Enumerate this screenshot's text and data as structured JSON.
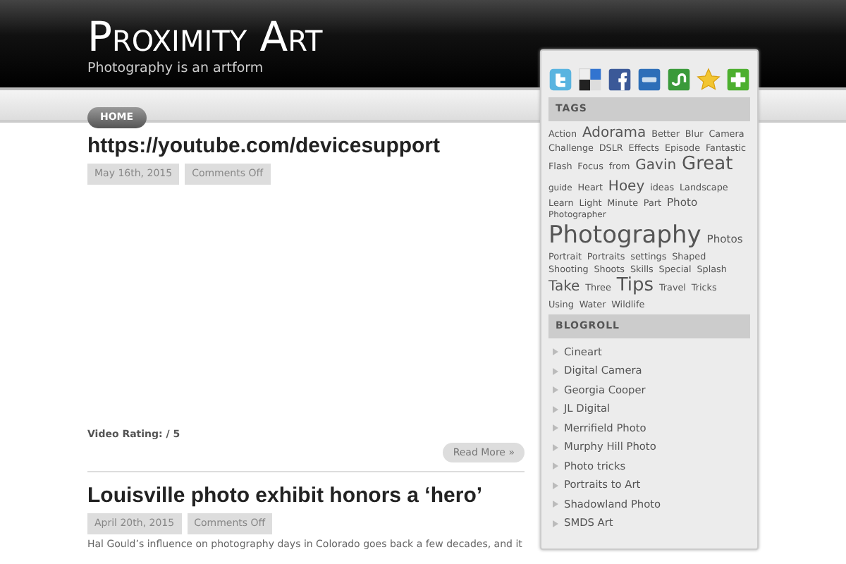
{
  "site": {
    "title": "Proximity Art",
    "tagline": "Photography is an artform"
  },
  "nav": [
    {
      "label": "HOME",
      "selected": true
    }
  ],
  "posts": [
    {
      "title": "https://youtube.com/devicesupport",
      "date": "May 16th, 2015",
      "comments": "Comments Off",
      "rating": "Video Rating: / 5",
      "read_more": "Read More »"
    },
    {
      "title": "Louisville photo exhibit honors a ‘hero’",
      "date": "April 20th, 2015",
      "comments": "Comments Off",
      "excerpt": "Hal Gould’s influence on photography days in Colorado goes back a few decades, and it"
    }
  ],
  "share_icons": [
    {
      "kind": "bird",
      "color": "#5ab4e0"
    },
    {
      "kind": "squares",
      "color": "#3274d0"
    },
    {
      "kind": "letter",
      "color": "#3b5998"
    },
    {
      "kind": "pill",
      "color": "#2d6eb8"
    },
    {
      "kind": "swirl",
      "color": "#3a9a3a"
    },
    {
      "kind": "star",
      "color": "#f2c531"
    },
    {
      "kind": "plus",
      "color": "#4caf2e"
    }
  ],
  "tags": {
    "heading": "TAGS",
    "items": [
      {
        "label": "Action",
        "kind": "s"
      },
      {
        "label": "Adorama",
        "kind": "m"
      },
      {
        "label": "Better",
        "kind": "s"
      },
      {
        "label": "Blur",
        "kind": "s"
      },
      {
        "label": "Camera",
        "kind": "s"
      },
      {
        "label": "Challenge",
        "kind": "s"
      },
      {
        "label": "DSLR",
        "kind": "s"
      },
      {
        "label": "Effects",
        "kind": "s"
      },
      {
        "label": "Episode",
        "kind": "s"
      },
      {
        "label": "Fantastic",
        "kind": "s"
      },
      {
        "label": "Flash",
        "kind": "s"
      },
      {
        "label": "Focus",
        "kind": "s"
      },
      {
        "label": "from",
        "kind": "s"
      },
      {
        "label": "Gavin",
        "kind": "m"
      },
      {
        "label": "Great",
        "kind": "l"
      },
      {
        "label": "guide",
        "kind": "xs"
      },
      {
        "label": "Heart",
        "kind": "s"
      },
      {
        "label": "Hoey",
        "kind": "m"
      },
      {
        "label": "ideas",
        "kind": "s"
      },
      {
        "label": "Landscape",
        "kind": "s"
      },
      {
        "label": "Learn",
        "kind": "s"
      },
      {
        "label": "Light",
        "kind": "s"
      },
      {
        "label": "Minute",
        "kind": "s"
      },
      {
        "label": "Part",
        "kind": "s"
      },
      {
        "label": "Photo",
        "kind": "sm"
      },
      {
        "label": "Photographer",
        "kind": "xs"
      },
      {
        "label": "Photography",
        "kind": "xl"
      },
      {
        "label": "Photos",
        "kind": "sm"
      },
      {
        "label": "Portrait",
        "kind": "s"
      },
      {
        "label": "Portraits",
        "kind": "s"
      },
      {
        "label": "settings",
        "kind": "s"
      },
      {
        "label": "Shaped",
        "kind": "s"
      },
      {
        "label": "Shooting",
        "kind": "s"
      },
      {
        "label": "Shoots",
        "kind": "s"
      },
      {
        "label": "Skills",
        "kind": "s"
      },
      {
        "label": "Special",
        "kind": "s"
      },
      {
        "label": "Splash",
        "kind": "s"
      },
      {
        "label": "Take",
        "kind": "m"
      },
      {
        "label": "Three",
        "kind": "s"
      },
      {
        "label": "Tips",
        "kind": "l"
      },
      {
        "label": "Travel",
        "kind": "s"
      },
      {
        "label": "Tricks",
        "kind": "s"
      },
      {
        "label": "Using",
        "kind": "s"
      },
      {
        "label": "Water",
        "kind": "s"
      },
      {
        "label": "Wildlife",
        "kind": "s"
      }
    ]
  },
  "blogroll": {
    "heading": "BLOGROLL",
    "items": [
      "Cineart",
      "Digital Camera",
      "Georgia Cooper",
      "JL Digital",
      "Merrifield Photo",
      "Murphy Hill Photo",
      "Photo tricks",
      "Portraits to Art",
      "Shadowland Photo",
      "SMDS Art"
    ]
  }
}
